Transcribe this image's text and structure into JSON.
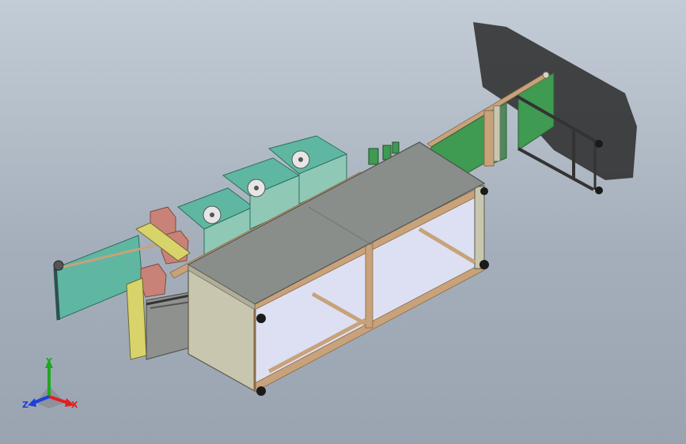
{
  "triad": {
    "x_label": "X",
    "y_label": "Y",
    "z_label": "Z",
    "x_color": "#e02020",
    "y_color": "#1fa81f",
    "z_color": "#1f3fd8"
  },
  "colors": {
    "background_top": "#c3ccd6",
    "background_bottom": "#9aa4b1",
    "table_top": "#8a8e8a",
    "table_side": "#c9c6b0",
    "frame_wood": "#c8a27a",
    "glass": "#dde0f2",
    "conveyor_green": "#3f9a52",
    "teal_panel": "#5fb7a2",
    "motor_block": "#c98277",
    "caster": "#1a1a1a"
  }
}
